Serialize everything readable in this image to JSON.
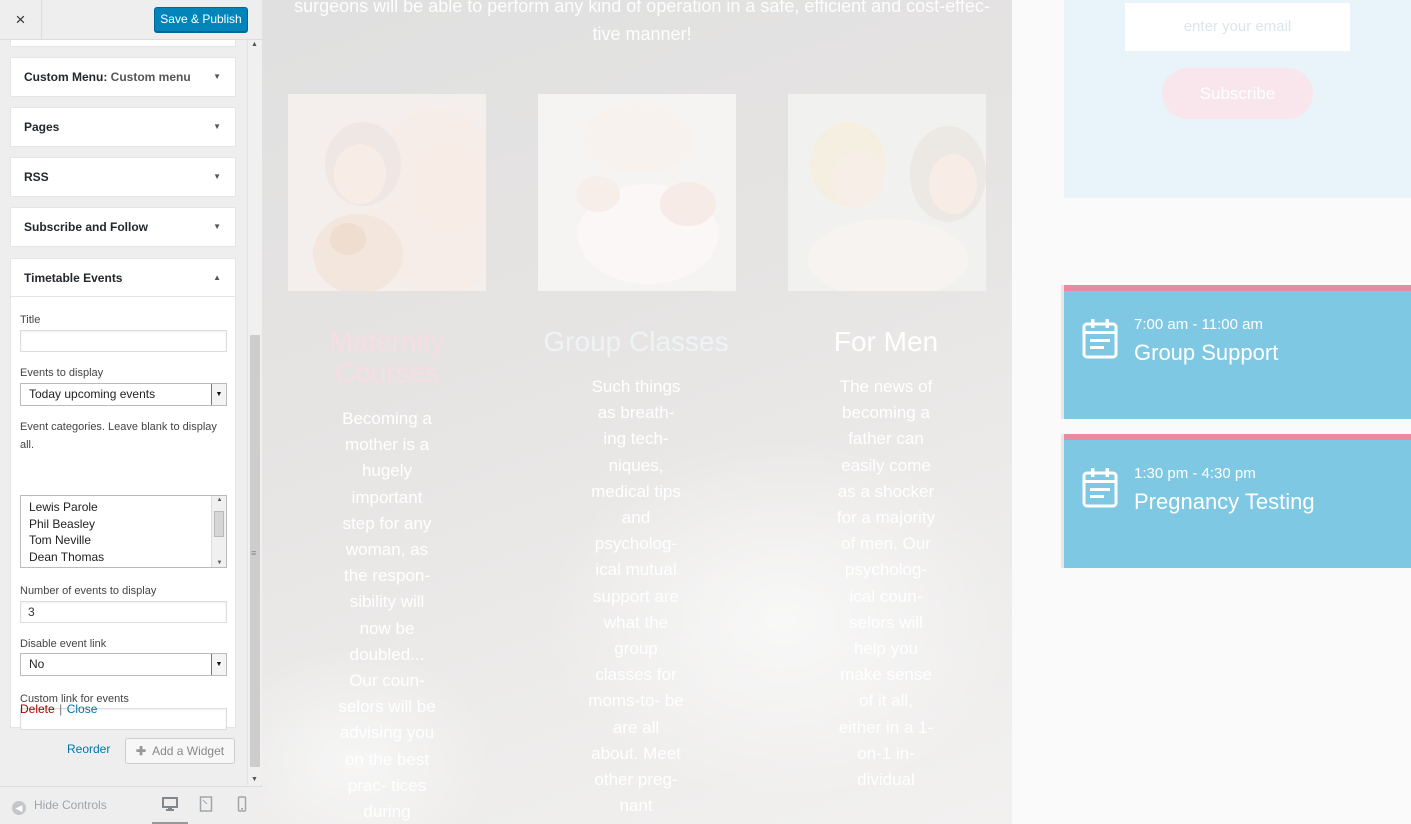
{
  "customizer": {
    "close_icon": "×",
    "publish_label": "Save & Publish",
    "widgets": [
      {
        "title": "Custom Menu:",
        "subtitle": "Custom menu"
      },
      {
        "title": "Pages"
      },
      {
        "title": "RSS"
      },
      {
        "title": "Subscribe and Follow"
      }
    ],
    "open_widget": {
      "title": "Timetable Events",
      "fields": {
        "title_label": "Title",
        "title_value": "",
        "events_label": "Events to display",
        "events_value": "Today upcoming events",
        "categories_label": "Event categories. Leave blank to display all.",
        "categories": [
          "Lewis Parole",
          "Phil Beasley",
          "Tom Neville",
          "Dean Thomas"
        ],
        "number_label": "Number of events to display",
        "number_value": "3",
        "disable_label": "Disable event link",
        "disable_value": "No",
        "custom_link_label": "Custom link for events",
        "custom_link_value": ""
      },
      "delete_label": "Delete",
      "separator": "|",
      "close_label": "Close"
    },
    "reorder_label": "Reorder",
    "add_widget_label": "Add a Widget",
    "hide_controls_label": "Hide Controls",
    "devices": [
      "desktop-icon",
      "tablet-icon",
      "mobile-icon"
    ]
  },
  "preview": {
    "top_text": "surgeons will be able to perform any kind of operation in a safe, efficient and cost-effec-\ntive manner!",
    "columns": [
      {
        "title": "Maternity Courses",
        "title_color": "#f7dde5",
        "body": "Becoming a mother is a hugely important step for any woman, as the respon- sibility will now be doubled... Our coun- selors will be advising you on the best prac- tices during"
      },
      {
        "title": "Group Classes",
        "title_color": "#eef3f6",
        "body": "Such things as breath- ing tech- niques, medical tips and psycholog- ical mutual support are what the group classes for moms-to- be are all about. Meet other preg- nant"
      },
      {
        "title": "For Men",
        "title_color": "#ffffff",
        "body": "The news of becoming a father can easily come as a shocker for a majority of men. Our psycholog- ical coun- selors will help you make sense of it all, either in a 1-on-1 in- dividual"
      }
    ],
    "subscribe": {
      "placeholder": "enter your email",
      "button_label": "Subscribe"
    },
    "events": [
      {
        "time": "7:00 am - 11:00 am",
        "title": "Group Support"
      },
      {
        "time": "1:30 pm - 4:30 pm",
        "title": "Pregnancy Testing"
      }
    ],
    "colors": {
      "event_bg": "#7ec8e3",
      "event_border": "#e88ba0",
      "publish_blue": "#0085ba",
      "subscribe_bg": "#e8f4f9"
    }
  }
}
